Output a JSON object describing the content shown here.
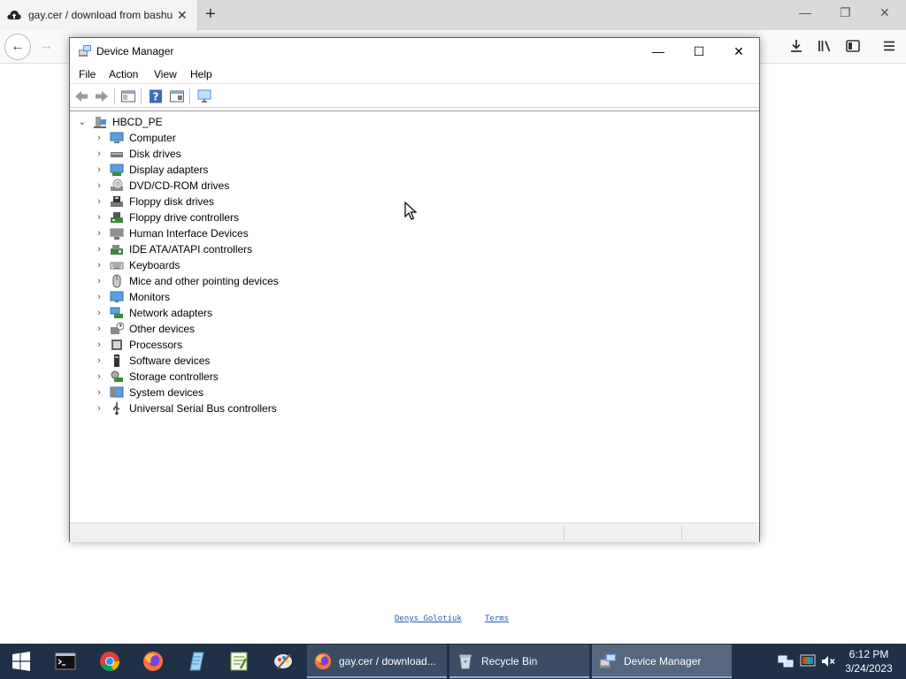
{
  "browser": {
    "tab_title": "gay.cer / download from bashu",
    "tab_close": "✕",
    "new_tab": "+",
    "win_minimize": "—",
    "win_restore": "❐",
    "win_close": "✕",
    "back": "←",
    "forward": "→",
    "footer_links": [
      "Denys Golotiuk",
      "Terms"
    ]
  },
  "device_manager": {
    "title": "Device Manager",
    "controls": {
      "minimize": "—",
      "maximize": "☐",
      "close": "✕"
    },
    "menu": [
      "File",
      "Action",
      "View",
      "Help"
    ],
    "root": {
      "label": "HBCD_PE",
      "chevron": "⌄"
    },
    "tree_items": [
      {
        "label": "Computer",
        "icon": "computer-icon"
      },
      {
        "label": "Disk drives",
        "icon": "disk-drive-icon"
      },
      {
        "label": "Display adapters",
        "icon": "display-adapter-icon"
      },
      {
        "label": "DVD/CD-ROM drives",
        "icon": "dvd-drive-icon"
      },
      {
        "label": "Floppy disk drives",
        "icon": "floppy-disk-icon"
      },
      {
        "label": "Floppy drive controllers",
        "icon": "floppy-controller-icon"
      },
      {
        "label": "Human Interface Devices",
        "icon": "hid-icon"
      },
      {
        "label": "IDE ATA/ATAPI controllers",
        "icon": "ide-controller-icon"
      },
      {
        "label": "Keyboards",
        "icon": "keyboard-icon"
      },
      {
        "label": "Mice and other pointing devices",
        "icon": "mouse-icon"
      },
      {
        "label": "Monitors",
        "icon": "monitor-icon"
      },
      {
        "label": "Network adapters",
        "icon": "network-adapter-icon"
      },
      {
        "label": "Other devices",
        "icon": "other-devices-icon"
      },
      {
        "label": "Processors",
        "icon": "processor-icon"
      },
      {
        "label": "Software devices",
        "icon": "software-device-icon"
      },
      {
        "label": "Storage controllers",
        "icon": "storage-controller-icon"
      },
      {
        "label": "System devices",
        "icon": "system-devices-icon"
      },
      {
        "label": "Universal Serial Bus controllers",
        "icon": "usb-icon"
      }
    ],
    "tree_chevron": "›"
  },
  "taskbar": {
    "tasks": [
      "gay.cer / download...",
      "Recycle Bin",
      "Device Manager"
    ],
    "clock_time": "6:12 PM",
    "clock_date": "3/24/2023"
  },
  "colors": {
    "taskbar": "#1f3146",
    "window_border": "#1e73c9",
    "link": "#2a5db0"
  }
}
